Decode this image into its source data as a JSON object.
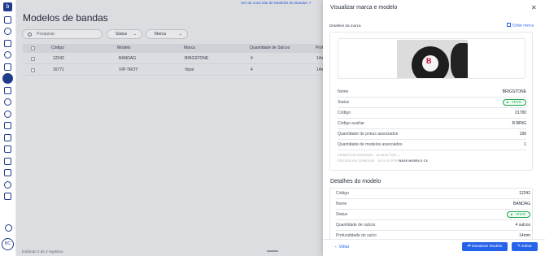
{
  "sidebar": {
    "logo": "b",
    "icons": [
      "home-icon",
      "search-icon",
      "bookmark-icon",
      "clock-icon",
      "upload-icon",
      "tire-icon",
      "transfer-icon",
      "user-icon",
      "gear-icon",
      "document-icon",
      "truck-icon",
      "doc-check-icon",
      "doc-list-icon",
      "grid-icon",
      "users-icon",
      "box-icon"
    ],
    "bottom_icon": "route-icon",
    "avatar": "BC"
  },
  "page": {
    "banner": "Ser da nova tela de Modelos de Bandas ↗",
    "title": "Modelos de bandas",
    "search_placeholder": "Pesquisar",
    "filters": [
      {
        "label": "Status"
      },
      {
        "label": "Marca"
      }
    ],
    "table": {
      "headers": [
        "Código",
        "Modelo",
        "Marca",
        "Quantidade de Sulcos",
        "Prof"
      ],
      "rows": [
        [
          "12242",
          "BANDAG",
          "BRIGSTONE",
          "4",
          "14mm"
        ],
        [
          "16771",
          "VIP-TROY",
          "Vipal",
          "4",
          "14mm"
        ]
      ]
    },
    "footer": "Exibindo 2 de 2 registros"
  },
  "drawer": {
    "title": "Visualizar marca e modelo",
    "brand_card": {
      "title": "Detalhes da marca",
      "edit_label": "Editar marca",
      "rows": [
        {
          "key": "Nome",
          "value": "BRIGSTONE"
        },
        {
          "key": "Status",
          "value": "ATIVO",
          "badge": true
        },
        {
          "key": "Código",
          "value": "21780"
        },
        {
          "key": "Código auxiliar",
          "value": "R-BRIG"
        },
        {
          "key": "Quantidade de pneus associados",
          "value": "196"
        },
        {
          "key": "Quantidade de modelos associados",
          "value": "1"
        }
      ],
      "created": "CRIADO EM 24/09/2025 · 15:54:52 POR —",
      "edited_prefix": "EDITADO EM 23/09/2026 · 15:21:25 POR",
      "edited_by": "BASE MODELO CX"
    },
    "model_section_title": "Detalhes do modelo",
    "model_card": {
      "rows": [
        {
          "key": "Código",
          "value": "12242"
        },
        {
          "key": "Nome",
          "value": "BANDAG"
        },
        {
          "key": "Status",
          "value": "ATIVO",
          "badge": true
        },
        {
          "key": "Quantidade de sulcos",
          "value": "4 sulcos"
        },
        {
          "key": "Profundidade do sulco",
          "value": "14mm"
        }
      ]
    },
    "actions": {
      "back": "Voltar",
      "deactivate": "Desativar Modelo",
      "edit": "Editar"
    }
  },
  "colors": {
    "accent": "#2563eb",
    "brand": "#1f3c8c",
    "success": "#16a34a"
  }
}
